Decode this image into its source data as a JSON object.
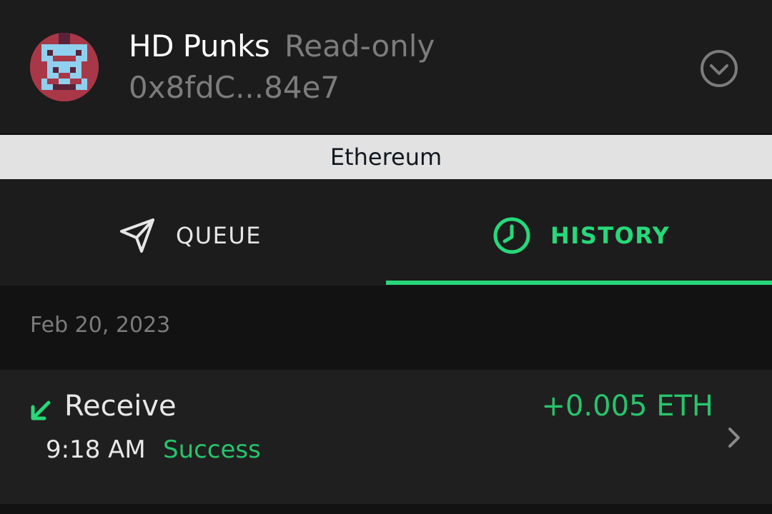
{
  "header": {
    "wallet_name": "HD Punks",
    "access_mode": "Read-only",
    "address": "0x8fdC...84e7",
    "avatar_icon": "pixel-punk-avatar-icon",
    "expand_icon": "chevron-down-circle-icon"
  },
  "network": {
    "label": "Ethereum"
  },
  "tabs": [
    {
      "label": "QUEUE",
      "icon": "paper-plane-icon",
      "active": false
    },
    {
      "label": "HISTORY",
      "icon": "clock-icon",
      "active": true
    }
  ],
  "history": {
    "date": "Feb 20, 2023",
    "transactions": [
      {
        "type": "Receive",
        "direction_icon": "arrow-down-left-icon",
        "amount": "+0.005 ETH",
        "time": "9:18 AM",
        "status": "Success",
        "open_icon": "chevron-right-icon"
      }
    ]
  },
  "colors": {
    "accent": "#27d87a",
    "success": "#27c46c",
    "background": "#121212",
    "surface": "#1c1c1c",
    "network_bar": "#e2e2e2",
    "muted_text": "#7c7c7c"
  }
}
